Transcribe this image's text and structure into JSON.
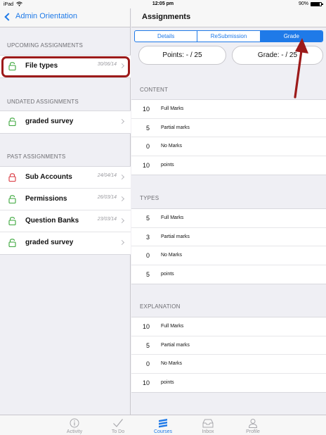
{
  "status_bar": {
    "device": "iPad",
    "time": "12:05 pm",
    "battery": "90%"
  },
  "nav_left": {
    "back_label": "Admin Orientation"
  },
  "nav_right": {
    "title": "Assignments"
  },
  "sections": {
    "upcoming": {
      "header": "UPCOMING ASSIGNMENTS",
      "items": [
        {
          "name": "File types",
          "date": "30/06/14",
          "locked": false
        }
      ]
    },
    "undated": {
      "header": "UNDATED ASSIGNMENTS",
      "items": [
        {
          "name": "graded survey",
          "date": "",
          "locked": false
        }
      ]
    },
    "past": {
      "header": "PAST ASSIGNMENTS",
      "items": [
        {
          "name": "Sub Accounts",
          "date": "24/04/14",
          "locked": true
        },
        {
          "name": "Permissions",
          "date": "26/03/14",
          "locked": false
        },
        {
          "name": "Question Banks",
          "date": "23/03/14",
          "locked": false
        },
        {
          "name": "graded survey",
          "date": "",
          "locked": false
        }
      ]
    }
  },
  "segments": {
    "details": "Details",
    "resubmission": "ReSubmission",
    "grade": "Grade",
    "selected": "Grade"
  },
  "points_pill": "Points: - / 25",
  "grade_pill": "Grade: - / 25",
  "rubric": {
    "content": {
      "header": "CONTENT",
      "rows": [
        {
          "value": "10",
          "label": "Full Marks"
        },
        {
          "value": "5",
          "label": "Partial marks"
        },
        {
          "value": "0",
          "label": "No Marks"
        },
        {
          "value": "10",
          "label": "points"
        }
      ]
    },
    "types": {
      "header": "TYPES",
      "rows": [
        {
          "value": "5",
          "label": "Full Marks"
        },
        {
          "value": "3",
          "label": "Partial marks"
        },
        {
          "value": "0",
          "label": "No Marks"
        },
        {
          "value": "5",
          "label": "points"
        }
      ]
    },
    "explanation": {
      "header": "EXPLANATION",
      "rows": [
        {
          "value": "10",
          "label": "Full Marks"
        },
        {
          "value": "5",
          "label": "Partial marks"
        },
        {
          "value": "0",
          "label": "No Marks"
        },
        {
          "value": "10",
          "label": "points"
        }
      ]
    }
  },
  "tabs": {
    "activity": "Activity",
    "todo": "To Do",
    "courses": "Courses",
    "inbox": "Inbox",
    "profile": "Profile",
    "active": "Courses"
  },
  "colors": {
    "accent": "#1f7ae8",
    "annotation": "#9c1a1a",
    "lock_open": "#3aa63a",
    "lock_closed": "#d9363e"
  }
}
